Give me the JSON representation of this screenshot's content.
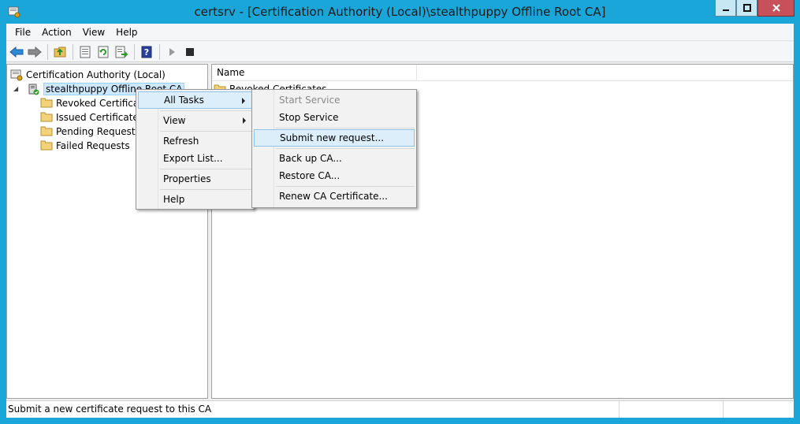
{
  "window": {
    "title": "certsrv - [Certification Authority (Local)\\stealthpuppy Offline Root CA]"
  },
  "menubar": {
    "items": [
      "File",
      "Action",
      "View",
      "Help"
    ]
  },
  "toolbar": {
    "icons": [
      "back-arrow-icon",
      "forward-arrow-icon",
      "up-folder-icon",
      "show-hide-tree-icon",
      "refresh-icon",
      "export-list-icon",
      "help-icon",
      "start-service-icon",
      "stop-service-icon"
    ]
  },
  "tree": {
    "root": "Certification Authority (Local)",
    "ca": "stealthpuppy Offline Root CA",
    "children": [
      "Revoked Certificates",
      "Issued Certificates",
      "Pending Requests",
      "Failed Requests"
    ]
  },
  "list": {
    "columns": [
      "Name"
    ],
    "rows": [
      "Revoked Certificates"
    ]
  },
  "context_menu": {
    "items": [
      "All Tasks",
      "View",
      "Refresh",
      "Export List...",
      "Properties",
      "Help"
    ]
  },
  "submenu": {
    "items": [
      "Start Service",
      "Stop Service",
      "Submit new request...",
      "Back up CA...",
      "Restore CA...",
      "Renew CA Certificate..."
    ]
  },
  "statusbar": {
    "text": "Submit a new certificate request to this CA"
  },
  "colors": {
    "frame": "#1aa6d8",
    "highlight": "#dbeefa",
    "selection": "#cce8ff"
  }
}
